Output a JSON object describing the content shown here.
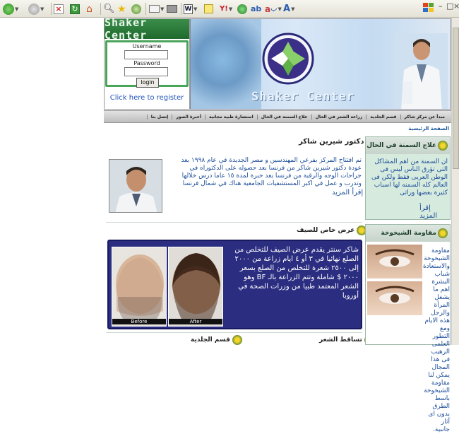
{
  "browser": {
    "toolbar_icons": [
      "back-icon",
      "forward-icon",
      "stop-icon",
      "refresh-icon",
      "home-icon",
      "search-icon",
      "favorites-icon",
      "history-icon",
      "mail-icon",
      "print-icon",
      "word-icon",
      "notes-icon",
      "yahoo-icon",
      "messenger-icon",
      "translate-icon",
      "font-icon",
      "windows-logo-icon"
    ],
    "accent": "#3a8a3a"
  },
  "header": {
    "brand": "Shaker Center",
    "banner_text": "Shaker Center",
    "login": {
      "username_label": "Username",
      "password_label": "Password",
      "login_button": "login",
      "register_link": "Click here to register"
    }
  },
  "nav": {
    "items": [
      "مبدأ عن مركز شاكر",
      "قسم الجلدية",
      "زراعة الشعر في الحال",
      "علاج السمنة في الحال",
      "استشارة طبية مجانية",
      "أخبرة الصور",
      "إتصل بنا"
    ]
  },
  "breadcrumb": "الصفحة الرئيسية",
  "main": {
    "doctor_title": "دكتور شيرين شاكر",
    "doctor_text": "تم افتتاح المركز بفرعي المهندسين و مصر الجديدة في عام ١٩٩٨ بعد عودة دكتور شيرين شاكر من فرنسا بعد حصوله على الدكتوراه في جراحات الوجه والرقبة من فرنسا بعد خبرة لمدة ١٥ عاما درس خلالها وتدرب و عمل في اكبر المستشفيات الجامعية هناك في شمال فرنسا",
    "read_more": "إقرأ المزيد",
    "offer_title": "عرض خاص للصيف",
    "offer_text": "شاكر سنتر يقدم عرض الصيف للتخلص من الصلع نهائيا في ٣ أو ٤ ايام زراعة من ٢٠٠٠ إلى ٢٥٠٠ شعرة للتخلص من الصلع بسعر ٢٠٠٠ $ شاملة وتتم الزراعة بالـ BF وهو الشعر المعتمد طبيا من وزرات الصحة في أوروبا",
    "before_label": "Before",
    "after_label": "After",
    "section_skin": "قسم الجلدية",
    "section_hair": "تساقط الشعر"
  },
  "sidebar": {
    "obesity_title": "علاج السمنة في الحال",
    "obesity_text": "ان السمنة من اهم المشاكل التى تؤرق الناس ليس فى الوطن العربى فقط ولكن فى العالم كله السمنه لها اسباب كثيرة بعضها وراثى",
    "obesity_read_more": "إقرأ المزيد",
    "aging_title": "مقاومة الشيخوخة",
    "aging_text": "مقاومة الشيخوخة والاستعادة شباب البشرة اهم ما يشغل المرأة والرجل هذه الايام ومع التطور العلمى الرهيب فى هذا المجال يمكن لنا مقاومة الشيخوخة باسط الطرق بدون اى آثار جانبية."
  }
}
